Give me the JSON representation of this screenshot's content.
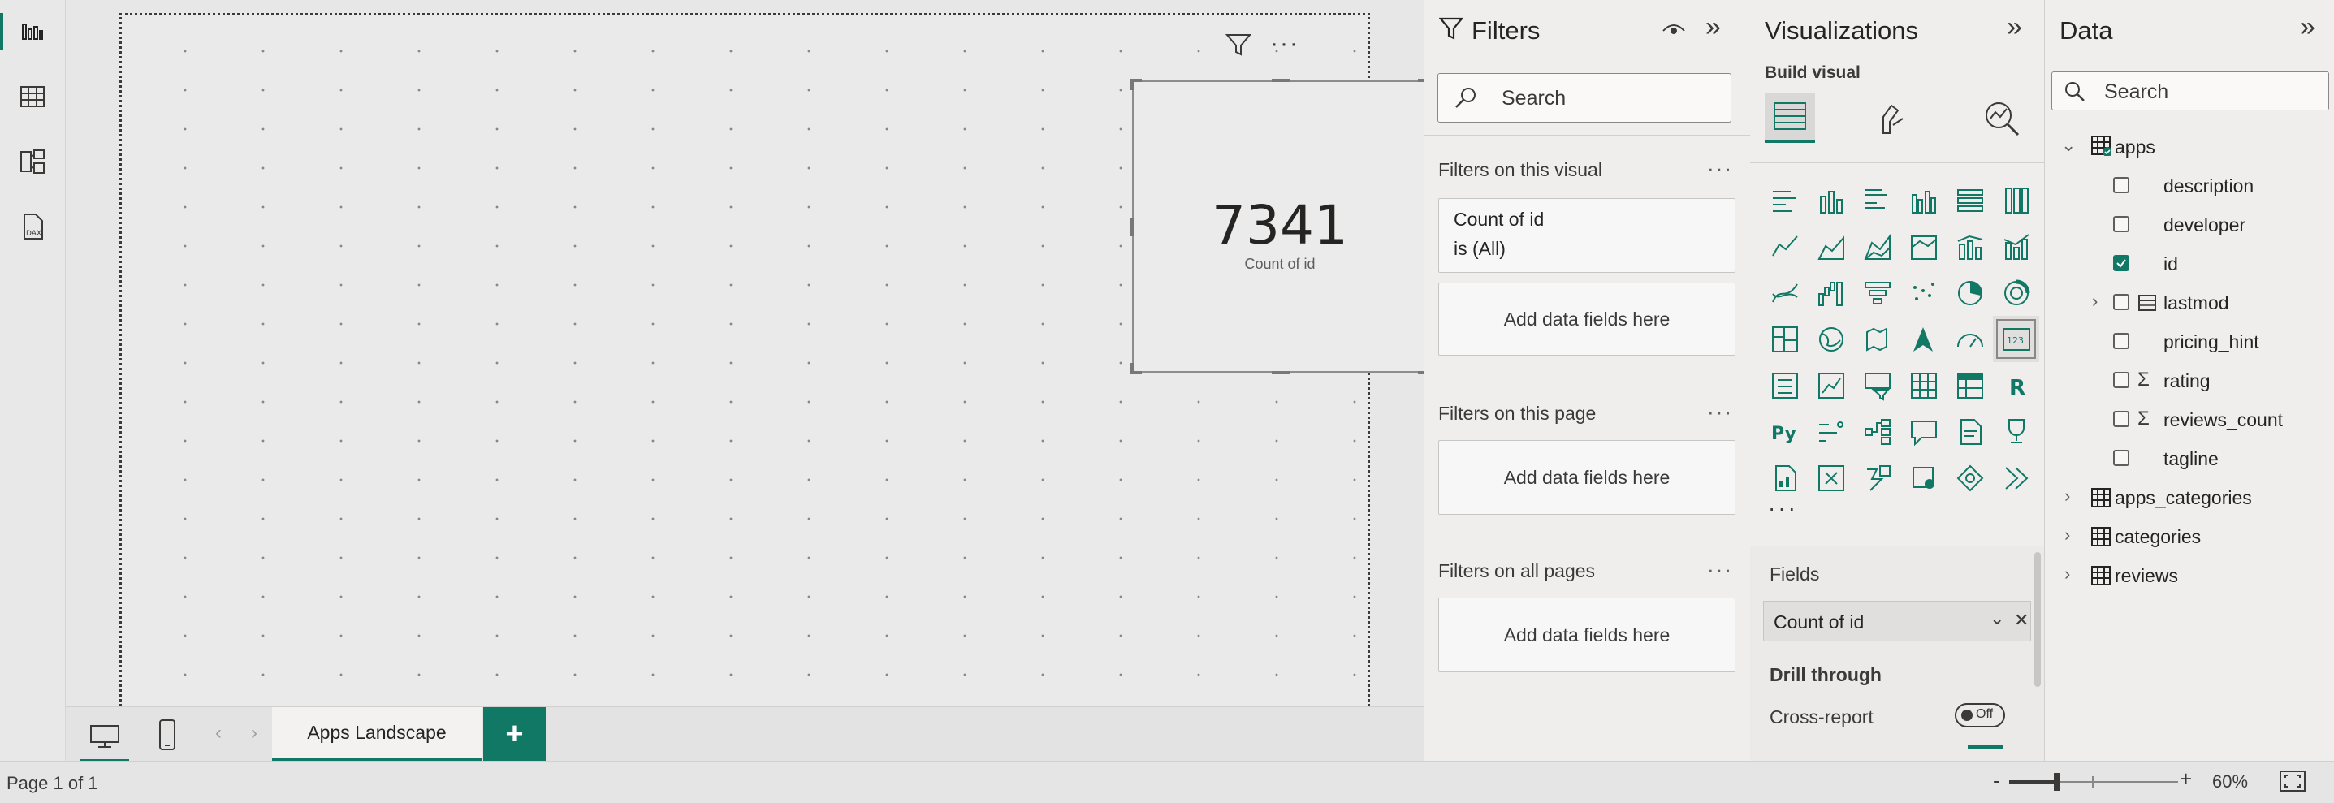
{
  "rail": {
    "items": [
      {
        "name": "report-view-icon"
      },
      {
        "name": "table-view-icon"
      },
      {
        "name": "model-view-icon"
      },
      {
        "name": "dax-query-view-icon"
      }
    ]
  },
  "canvas": {
    "card": {
      "value": "7341",
      "label": "Count of id"
    }
  },
  "page_tabs": {
    "tabs": [
      {
        "label": "Apps Landscape",
        "active": true
      }
    ],
    "add_label": "+"
  },
  "filters": {
    "title": "Filters",
    "search_placeholder": "Search",
    "sections": {
      "visual": {
        "title": "Filters on this visual",
        "card_field": "Count of id",
        "card_condition": "is (All)",
        "add": "Add data fields here"
      },
      "page": {
        "title": "Filters on this page",
        "add": "Add data fields here"
      },
      "all": {
        "title": "Filters on all pages",
        "add": "Add data fields here"
      }
    },
    "more": "···"
  },
  "visualizations": {
    "title": "Visualizations",
    "build_visual": "Build visual",
    "more": "···",
    "fields_label": "Fields",
    "field_well": "Count of id",
    "drill_through": "Drill through",
    "cross_report": "Cross-report",
    "toggle": "Off"
  },
  "data": {
    "title": "Data",
    "search_placeholder": "Search",
    "tables": [
      {
        "name": "apps",
        "expanded": true,
        "fields": [
          {
            "name": "description",
            "checked": false,
            "type": "text"
          },
          {
            "name": "developer",
            "checked": false,
            "type": "text"
          },
          {
            "name": "id",
            "checked": true,
            "type": "text"
          },
          {
            "name": "lastmod",
            "checked": false,
            "type": "date"
          },
          {
            "name": "pricing_hint",
            "checked": false,
            "type": "text"
          },
          {
            "name": "rating",
            "checked": false,
            "type": "sum"
          },
          {
            "name": "reviews_count",
            "checked": false,
            "type": "sum"
          },
          {
            "name": "tagline",
            "checked": false,
            "type": "text"
          }
        ]
      },
      {
        "name": "apps_categories",
        "expanded": false
      },
      {
        "name": "categories",
        "expanded": false
      },
      {
        "name": "reviews",
        "expanded": false
      }
    ]
  },
  "status": {
    "page_info": "Page 1 of 1",
    "zoom": "60%",
    "zoom_level": 0.6
  },
  "colors": {
    "accent": "#117865",
    "pane_bg": "#efeeed",
    "canvas_bg": "#eaeaea"
  }
}
